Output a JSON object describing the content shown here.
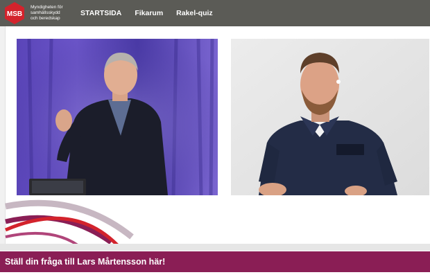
{
  "header": {
    "logo": {
      "text": "MSB",
      "tagline_lines": [
        "Myndigheten för",
        "samhällsskydd",
        "och beredskap"
      ]
    },
    "nav": [
      {
        "label": "STARTSIDA"
      },
      {
        "label": "Fikarum"
      },
      {
        "label": "Rakel-quiz"
      }
    ]
  },
  "videos": [
    {
      "participant": "presenter-left"
    },
    {
      "participant": "presenter-right"
    }
  ],
  "banner": {
    "label": "Ställ din fråga till Lars Mårtensson här!"
  },
  "colors": {
    "header_bg": "#5b5b56",
    "brand_red": "#d3232c",
    "banner_bg": "#8a1e55"
  }
}
